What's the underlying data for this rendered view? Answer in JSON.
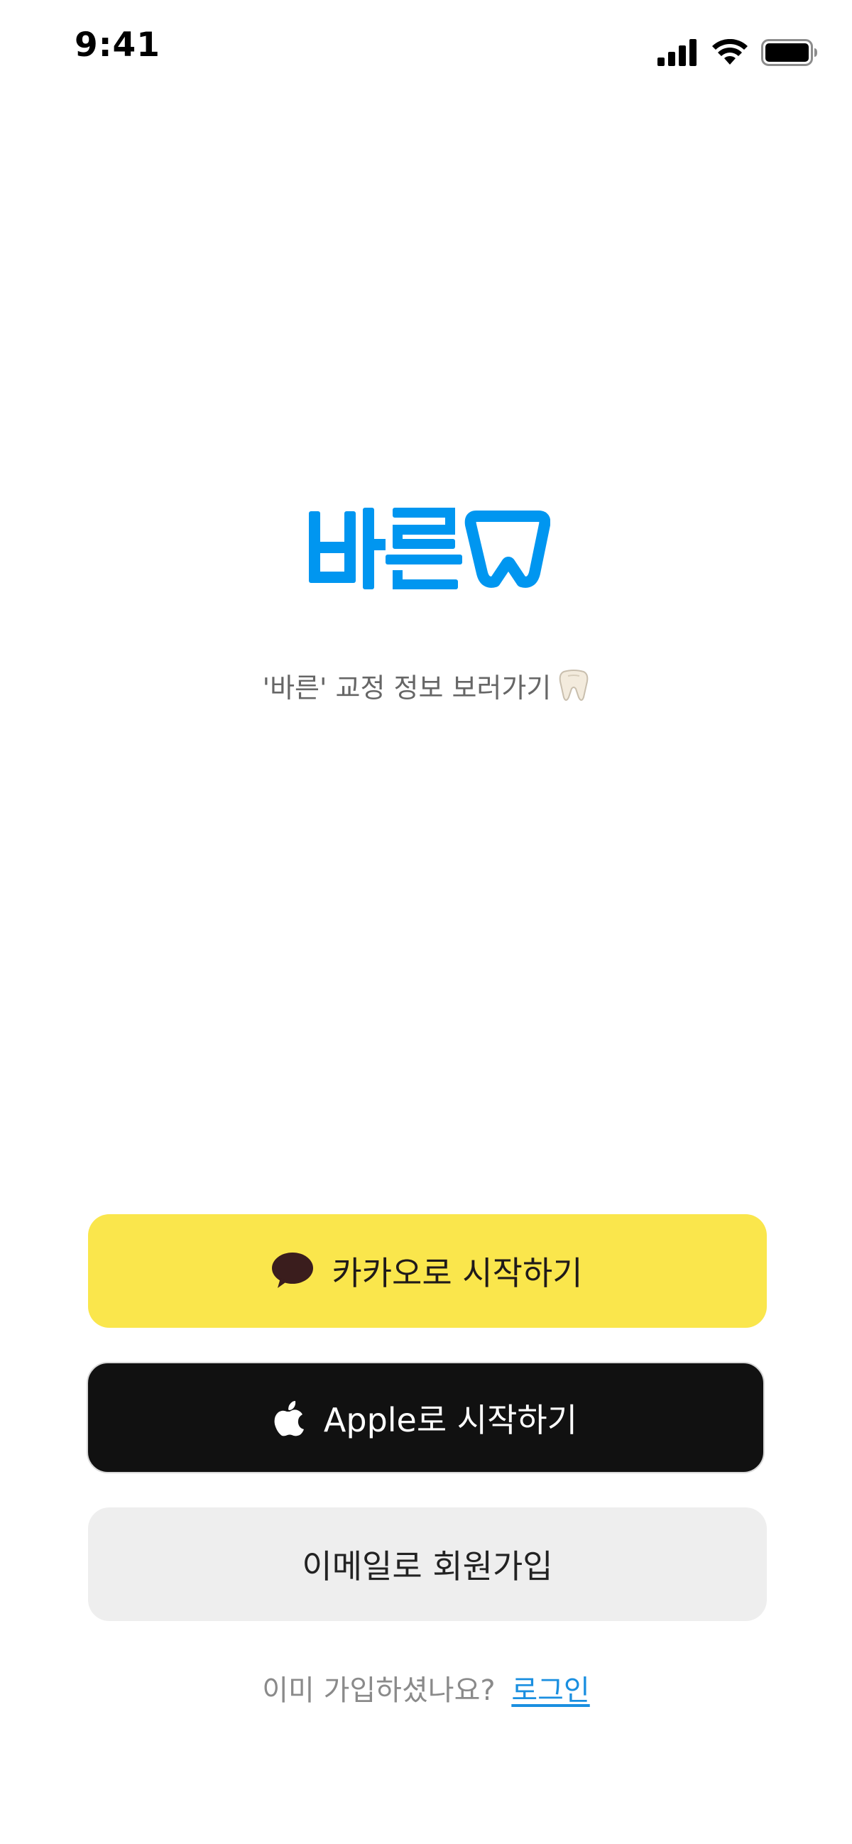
{
  "status_bar": {
    "time": "9:41",
    "icons": [
      "signal-icon",
      "wifi-icon",
      "battery-icon"
    ]
  },
  "logo": {
    "text": "바른",
    "icon": "tooth-outline-icon",
    "color": "#0096F0"
  },
  "tagline": {
    "text": "'바른' 교정 정보 보러가기",
    "icon": "tooth-icon"
  },
  "buttons": {
    "kakao": {
      "label": "카카오로 시작하기",
      "icon": "speech-bubble-icon",
      "bg": "#FAE64C"
    },
    "apple": {
      "label": "Apple로 시작하기",
      "icon": "apple-icon",
      "bg": "#111111"
    },
    "email": {
      "label": "이메일로 회원가입",
      "bg": "#EEEEEE"
    }
  },
  "login": {
    "prompt": "이미 가입하셨나요?",
    "link": "로그인",
    "link_color": "#1A8FE0"
  }
}
